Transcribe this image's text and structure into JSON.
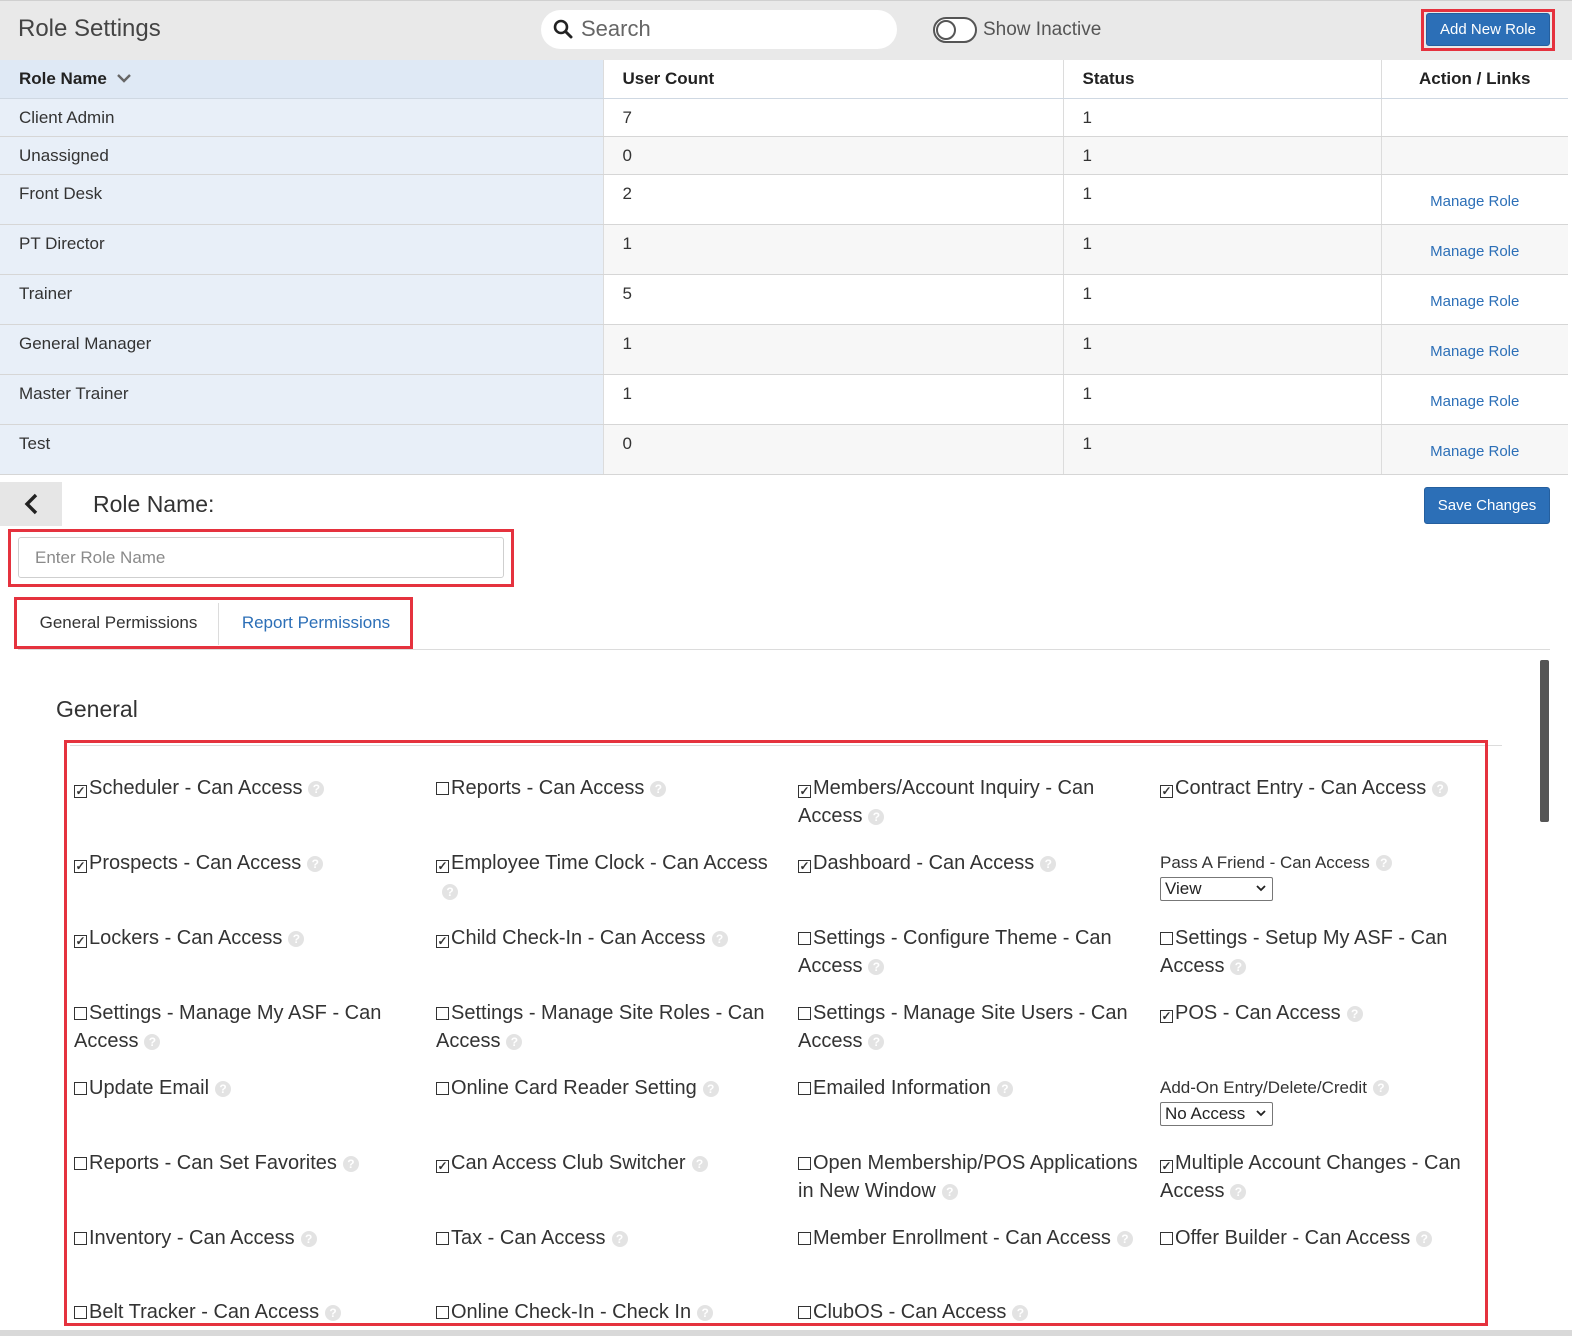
{
  "header": {
    "title": "Role Settings",
    "search_placeholder": "Search",
    "toggle_label": "Show Inactive",
    "add_button": "Add New Role"
  },
  "table": {
    "columns": [
      "Role Name",
      "User Count",
      "Status",
      "Action / Links"
    ],
    "link_label": "Manage Role",
    "rows": [
      {
        "name": "Client Admin",
        "count": "7",
        "status": "1",
        "link": ""
      },
      {
        "name": "Unassigned",
        "count": "0",
        "status": "1",
        "link": ""
      },
      {
        "name": "Front Desk",
        "count": "2",
        "status": "1",
        "link": "Manage Role"
      },
      {
        "name": "PT Director",
        "count": "1",
        "status": "1",
        "link": "Manage Role"
      },
      {
        "name": "Trainer",
        "count": "5",
        "status": "1",
        "link": "Manage Role"
      },
      {
        "name": "General Manager",
        "count": "1",
        "status": "1",
        "link": "Manage Role"
      },
      {
        "name": "Master Trainer",
        "count": "1",
        "status": "1",
        "link": "Manage Role"
      },
      {
        "name": "Test",
        "count": "0",
        "status": "1",
        "link": "Manage Role"
      }
    ]
  },
  "editor": {
    "role_label": "Role Name:",
    "save_button": "Save Changes",
    "name_placeholder": "Enter Role Name",
    "tabs": [
      "General Permissions",
      "Report Permissions"
    ],
    "section_title": "General"
  },
  "permissions": [
    {
      "label": "Scheduler - Can Access",
      "checked": true
    },
    {
      "label": "Reports - Can Access",
      "checked": false
    },
    {
      "label": "Members/Account Inquiry - Can Access",
      "checked": true
    },
    {
      "label": "Contract Entry - Can Access",
      "checked": true
    },
    {
      "label": "Prospects - Can Access",
      "checked": true
    },
    {
      "label": "Employee Time Clock - Can Access",
      "checked": true
    },
    {
      "label": "Dashboard - Can Access",
      "checked": true
    },
    {
      "label": "Pass A Friend - Can Access",
      "select": "View"
    },
    {
      "label": "Lockers - Can Access",
      "checked": true
    },
    {
      "label": "Child Check-In - Can Access",
      "checked": true
    },
    {
      "label": "Settings - Configure Theme - Can Access",
      "checked": false
    },
    {
      "label": "Settings - Setup My ASF - Can Access",
      "checked": false
    },
    {
      "label": "Settings - Manage My ASF - Can Access",
      "checked": false
    },
    {
      "label": "Settings - Manage Site Roles - Can Access",
      "checked": false
    },
    {
      "label": "Settings - Manage Site Users - Can Access",
      "checked": false
    },
    {
      "label": "POS - Can Access",
      "checked": true
    },
    {
      "label": "Update Email",
      "checked": false
    },
    {
      "label": "Online Card Reader Setting",
      "checked": false
    },
    {
      "label": "Emailed Information",
      "checked": false
    },
    {
      "label": "Add-On Entry/Delete/Credit",
      "select": "No Access"
    },
    {
      "label": "Reports - Can Set Favorites",
      "checked": false
    },
    {
      "label": "Can Access Club Switcher",
      "checked": true
    },
    {
      "label": "Open Membership/POS Applications in New Window",
      "checked": false
    },
    {
      "label": "Multiple Account Changes - Can Access",
      "checked": true
    },
    {
      "label": "Inventory - Can Access",
      "checked": false
    },
    {
      "label": "Tax - Can Access",
      "checked": false
    },
    {
      "label": "Member Enrollment - Can Access",
      "checked": false
    },
    {
      "label": "Offer Builder - Can Access",
      "checked": false
    },
    {
      "label": "Belt Tracker - Can Access",
      "checked": false
    },
    {
      "label": "Online Check-In - Check In",
      "checked": false
    },
    {
      "label": "ClubOS - Can Access",
      "checked": false
    }
  ],
  "colors": {
    "primary": "#2c6fb7",
    "highlight": "#e5323e",
    "header_bg": "#e9e9e9"
  }
}
